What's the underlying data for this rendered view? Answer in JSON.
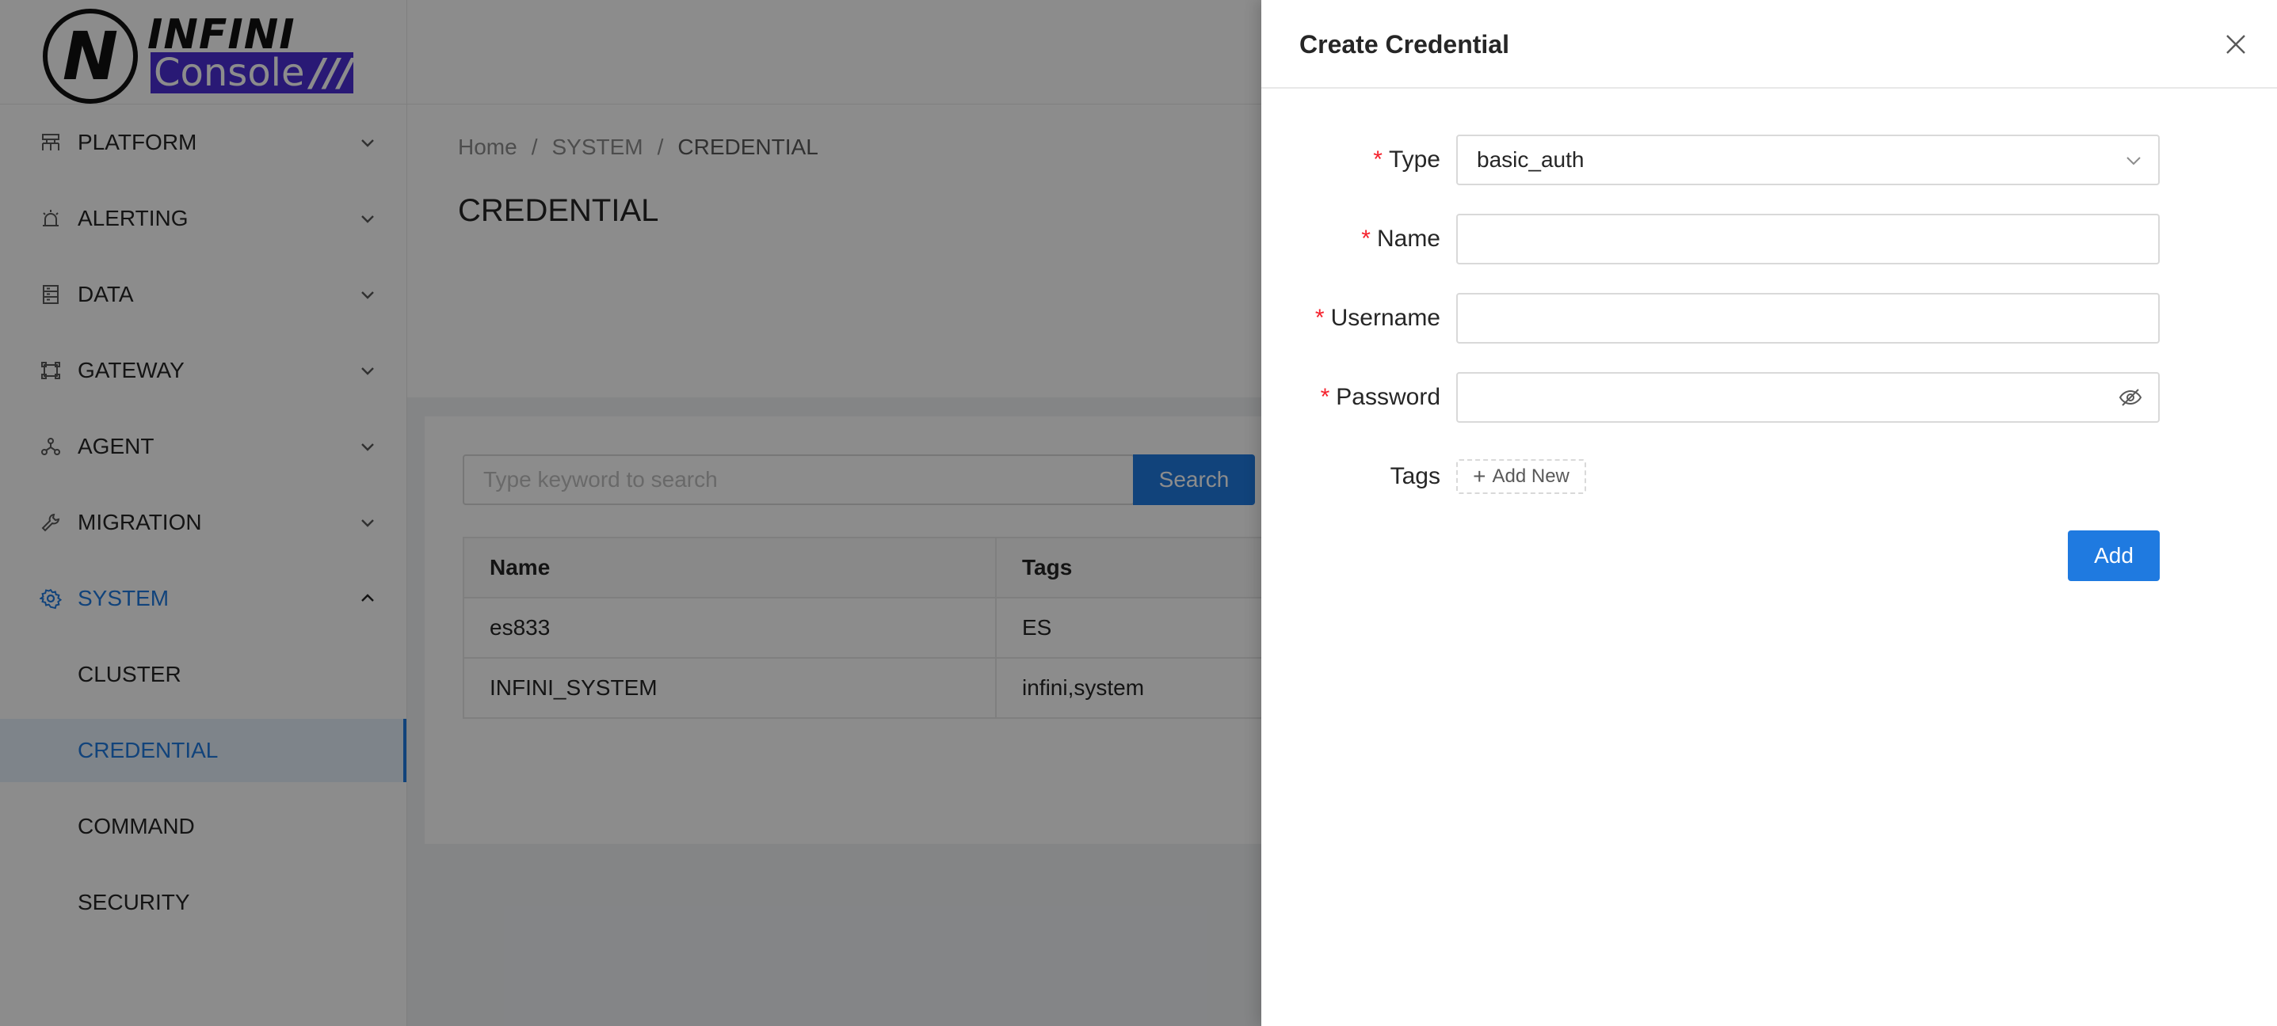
{
  "app": {
    "logo_top": "INFINI",
    "logo_bottom": "Console",
    "logo_slashes": "///"
  },
  "sidebar": {
    "items": [
      {
        "label": "PLATFORM",
        "icon": "platform-icon"
      },
      {
        "label": "ALERTING",
        "icon": "alarm-icon"
      },
      {
        "label": "DATA",
        "icon": "database-icon"
      },
      {
        "label": "GATEWAY",
        "icon": "gateway-icon"
      },
      {
        "label": "AGENT",
        "icon": "agent-icon"
      },
      {
        "label": "MIGRATION",
        "icon": "wrench-icon"
      },
      {
        "label": "SYSTEM",
        "icon": "gear-icon"
      }
    ],
    "system_children": [
      "CLUSTER",
      "CREDENTIAL",
      "COMMAND",
      "SECURITY"
    ],
    "selected": "CREDENTIAL"
  },
  "breadcrumb": {
    "home": "Home",
    "system": "SYSTEM",
    "current": "CREDENTIAL",
    "separator": "/"
  },
  "page": {
    "title": "CREDENTIAL"
  },
  "search": {
    "placeholder": "Type keyword to search",
    "button": "Search"
  },
  "table": {
    "columns": [
      "Name",
      "Tags"
    ],
    "rows": [
      [
        "es833",
        "ES"
      ],
      [
        "INFINI_SYSTEM",
        "infini,system"
      ]
    ]
  },
  "drawer": {
    "title": "Create Credential",
    "fields": {
      "type_label": "Type",
      "type_value": "basic_auth",
      "name_label": "Name",
      "name_value": "",
      "username_label": "Username",
      "username_value": "",
      "password_label": "Password",
      "password_value": "",
      "tags_label": "Tags",
      "tags_add": "Add New"
    },
    "required_mark": "*",
    "submit": "Add"
  },
  "colors": {
    "primary": "#1f7ae0",
    "required": "#f5222d",
    "brand_console_bg": "#4c2fd6"
  }
}
